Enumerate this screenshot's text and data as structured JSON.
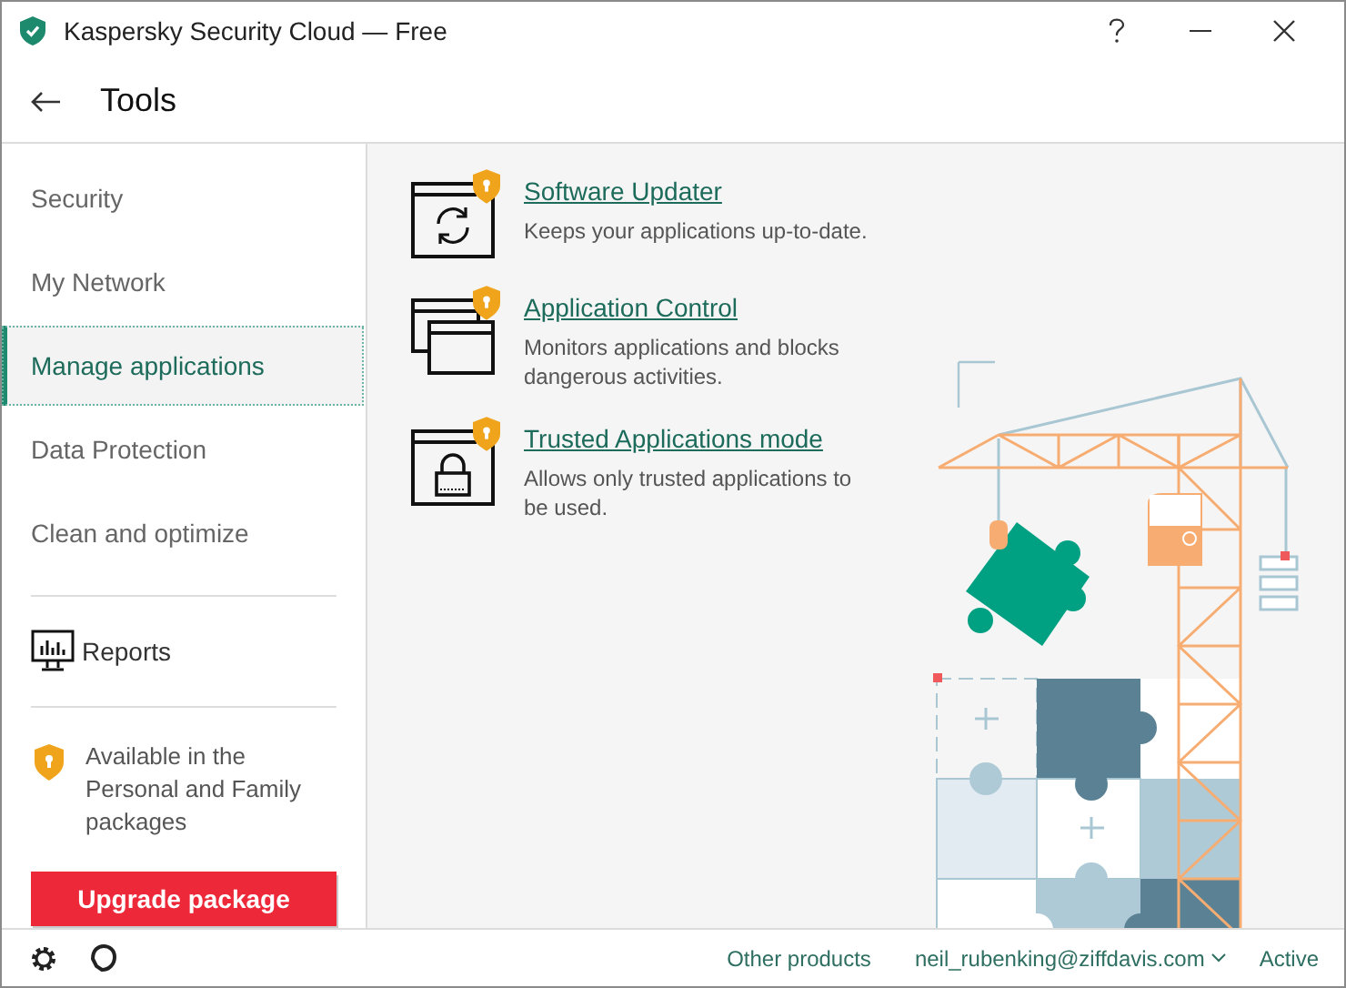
{
  "window": {
    "title": "Kaspersky Security Cloud — Free"
  },
  "header": {
    "title": "Tools"
  },
  "sidebar": {
    "items": [
      {
        "label": "Security",
        "selected": false
      },
      {
        "label": "My Network",
        "selected": false
      },
      {
        "label": "Manage applications",
        "selected": true
      },
      {
        "label": "Data Protection",
        "selected": false
      },
      {
        "label": "Clean and optimize",
        "selected": false
      }
    ],
    "reports": "Reports",
    "upgrade_note": "Available in the Personal and Family packages",
    "upgrade_button": "Upgrade package"
  },
  "tools": [
    {
      "kind": "updater",
      "title": "Software Updater",
      "description": "Keeps your applications up-to-date.",
      "locked": true
    },
    {
      "kind": "control",
      "title": "Application Control",
      "description": "Monitors applications and blocks dangerous activities.",
      "locked": true
    },
    {
      "kind": "trusted",
      "title": "Trusted Applications mode",
      "description": "Allows only trusted applications to be used.",
      "locked": true
    }
  ],
  "footer": {
    "other_products": "Other products",
    "account": "neil_rubenking@ziffdavis.com",
    "status": "Active"
  }
}
